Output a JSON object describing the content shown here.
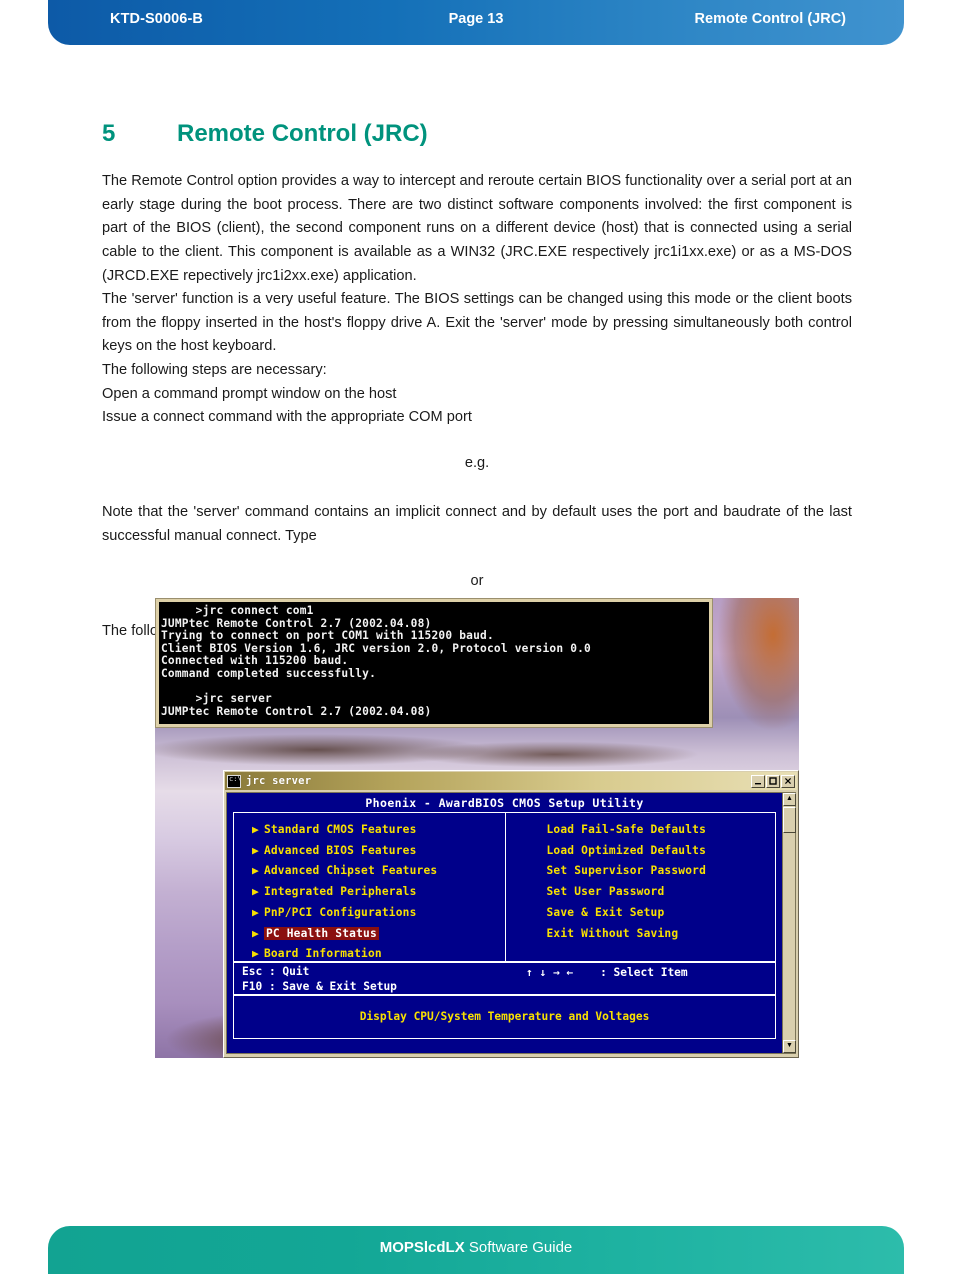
{
  "header": {
    "left": "KTD-S0006-B",
    "center": "Page 13",
    "right": "Remote Control (JRC)"
  },
  "heading": {
    "number": "5",
    "title": "Remote Control (JRC)",
    "color": "#00937d"
  },
  "body": {
    "p1": "The Remote Control option provides a way to intercept and reroute certain BIOS functionality over a serial port at an early stage during the boot process. There are two distinct software components involved: the first component is part of the BIOS (client), the second component runs on a different device (host) that is connected using a serial cable to the client. This component is available as a WIN32 (JRC.EXE respectively jrc1i1xx.exe) or as a MS-DOS (JRCD.EXE repectively jrc1i2xx.exe) application.",
    "p2": "The 'server' function is a very useful feature. The BIOS settings can be changed using this mode or the client boots from the floppy inserted in the host's floppy drive A. Exit the 'server' mode by pressing simultaneously both control keys on the host keyboard.",
    "p3": "The following steps are necessary:",
    "p4": "Open a command prompt window on the host",
    "p5": "Issue a connect command with the appropriate COM port",
    "eg": "e.g.",
    "p6": "Note that the 'server' command contains an implicit connect and by default uses the port and baudrate of the last successful manual connect. Type",
    "or": "or",
    "p7": "The following picture shows an example (press the 'Del' key on the client keyboard):"
  },
  "figure": {
    "console": {
      "lines": [
        "     >jrc connect com1",
        "JUMPtec Remote Control 2.7 (2002.04.08)",
        "Trying to connect on port COM1 with 115200 baud.",
        "Client BIOS Version 1.6, JRC version 2.0, Protocol version 0.0",
        "Connected with 115200 baud.",
        "Command completed successfully.",
        "",
        "     >jrc server",
        "JUMPtec Remote Control 2.7 (2002.04.08)"
      ]
    },
    "bios_window": {
      "titlebar": {
        "title": "jrc server",
        "icon": "console-icon",
        "minimize": "_",
        "maximize": "□",
        "close": "×"
      },
      "scrollbar": {
        "up_arrow": "▲",
        "down_arrow": "▼"
      },
      "screen_title": "Phoenix - AwardBIOS CMOS Setup Utility",
      "left_menu": [
        "Standard CMOS Features",
        "Advanced BIOS Features",
        "Advanced Chipset Features",
        "Integrated Peripherals",
        "PnP/PCI Configurations",
        "PC Health Status",
        "Board Information"
      ],
      "selected_index": 5,
      "right_menu": [
        "Load Fail-Safe Defaults",
        "Load Optimized Defaults",
        "Set Supervisor Password",
        "Set User Password",
        "Save & Exit Setup",
        "Exit Without Saving"
      ],
      "help_keys_left": "Esc : Quit\nF10 : Save & Exit Setup",
      "help_keys_right": "↑ ↓ → ←    : Select Item",
      "description": "Display CPU/System Temperature and Voltages",
      "colors": {
        "screen_bg": "#00008a",
        "menu_text": "#f8e000",
        "selected_bg": "#8a1010",
        "frame": "#ffffff"
      }
    }
  },
  "footer": {
    "bold": "MOPSlcdLX",
    "rest": " Software Guide"
  }
}
